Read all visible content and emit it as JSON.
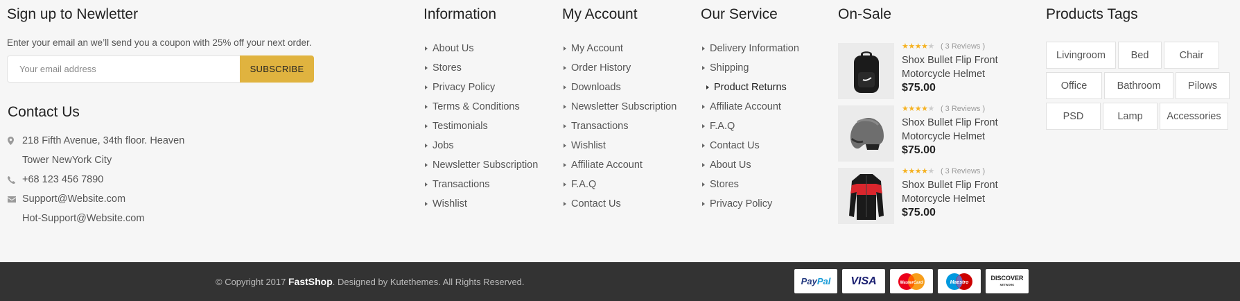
{
  "newsletter": {
    "title": "Sign up to Newletter",
    "description": "Enter your email an we’ll send you a coupon with 25% off your next order.",
    "email_placeholder": "Your email address",
    "button_label": "SUBSCRIBE",
    "button_color": "#e0b33f"
  },
  "contact": {
    "title": "Contact Us",
    "address_line1": "218 Fifth Avenue, 34th floor. Heaven",
    "address_line2": "Tower NewYork City",
    "phone": "+68 123 456 7890",
    "email1": "Support@Website.com",
    "email2": "Hot-Support@Website.com",
    "icons": [
      "map-pin-icon",
      "phone-icon",
      "envelope-icon"
    ]
  },
  "information": {
    "title": "Information",
    "items": [
      "About Us",
      "Stores",
      "Privacy Policy",
      "Terms & Conditions",
      "Testimonials",
      "Jobs",
      "Newsletter Subscription",
      "Transactions",
      "Wishlist"
    ]
  },
  "my_account": {
    "title": "My Account",
    "items": [
      "My Account",
      "Order History",
      "Downloads",
      "Newsletter Subscription",
      "Transactions",
      "Wishlist",
      "Affiliate Account",
      "F.A.Q",
      "Contact Us"
    ]
  },
  "our_service": {
    "title": "Our Service",
    "items": [
      "Delivery Information",
      "Shipping",
      "Product Returns",
      "Affiliate Account",
      "F.A.Q",
      "Contact Us",
      "About Us",
      "Stores",
      "Privacy Policy"
    ],
    "active_item": "Product Returns"
  },
  "on_sale": {
    "title": "On-Sale",
    "products": [
      {
        "rating": 4,
        "reviews": "( 3 Reviews )",
        "name": "Shox Bullet Flip Front Motorcycle Helmet",
        "price": "$75.00",
        "image": "backpack"
      },
      {
        "rating": 4,
        "reviews": "( 3 Reviews )",
        "name": "Shox Bullet Flip Front Motorcycle Helmet",
        "price": "$75.00",
        "image": "helmet"
      },
      {
        "rating": 4,
        "reviews": "( 3 Reviews )",
        "name": "Shox Bullet Flip Front Motorcycle Helmet",
        "price": "$75.00",
        "image": "jacket"
      }
    ]
  },
  "tags": {
    "title": "Products Tags",
    "rows": [
      [
        "Livingroom",
        "Bed",
        "Chair"
      ],
      [
        "Office",
        "Bathroom",
        "Pilows"
      ],
      [
        "PSD",
        "Lamp",
        "Accessories"
      ]
    ]
  },
  "bottom_bar": {
    "copyright_prefix": "© Copyright 2017",
    "brand": "FastShop",
    "copyright_suffix": ". Designed by Kutethemes. All Rights Reserved.",
    "payment_methods": [
      "PayPal",
      "VISA",
      "MasterCard",
      "Maestro",
      "DISCOVER"
    ]
  }
}
